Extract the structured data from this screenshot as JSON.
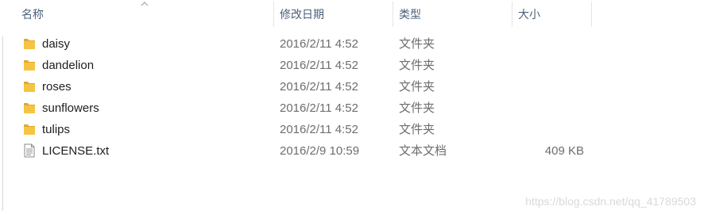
{
  "header": {
    "name_label": "名称",
    "date_label": "修改日期",
    "type_label": "类型",
    "size_label": "大小"
  },
  "files": [
    {
      "name": "daisy",
      "date": "2016/2/11 4:52",
      "type": "文件夹",
      "size": "",
      "icon": "folder-icon"
    },
    {
      "name": "dandelion",
      "date": "2016/2/11 4:52",
      "type": "文件夹",
      "size": "",
      "icon": "folder-icon"
    },
    {
      "name": "roses",
      "date": "2016/2/11 4:52",
      "type": "文件夹",
      "size": "",
      "icon": "folder-icon"
    },
    {
      "name": "sunflowers",
      "date": "2016/2/11 4:52",
      "type": "文件夹",
      "size": "",
      "icon": "folder-icon"
    },
    {
      "name": "tulips",
      "date": "2016/2/11 4:52",
      "type": "文件夹",
      "size": "",
      "icon": "folder-icon"
    },
    {
      "name": "LICENSE.txt",
      "date": "2016/2/9 10:59",
      "type": "文本文档",
      "size": "409 KB",
      "icon": "text-file-icon"
    }
  ],
  "watermark": "https://blog.csdn.net/qq_41789503",
  "colors": {
    "folder": "#f4c542",
    "folder_dark": "#e0a92a",
    "header_text": "#4c607a",
    "row_text": "#1e1e1e",
    "meta_text": "#6d6d6d"
  }
}
